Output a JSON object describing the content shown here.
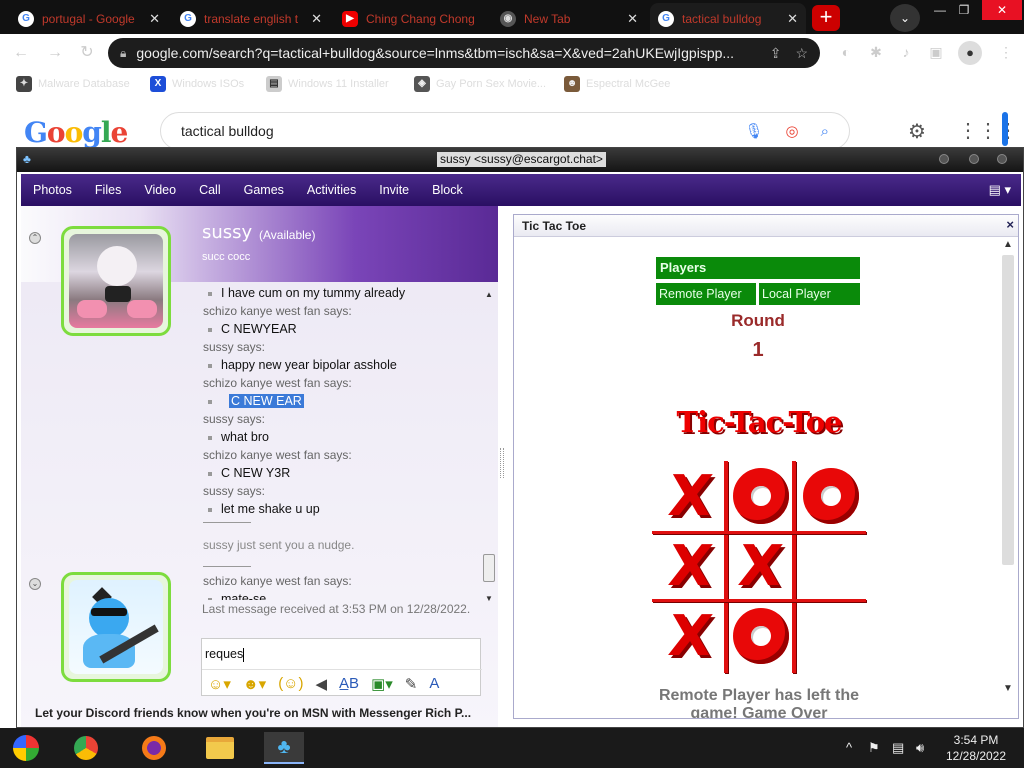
{
  "browser": {
    "tabs": [
      {
        "label": "portugal - Google",
        "icon": "google-icon"
      },
      {
        "label": "translate english t",
        "icon": "google-icon"
      },
      {
        "label": "Ching Chang Chong",
        "icon": "youtube-icon"
      },
      {
        "label": "New Tab",
        "icon": "chrome-icon"
      },
      {
        "label": "tactical bulldog",
        "icon": "google-icon"
      }
    ],
    "new_tab": "+",
    "url": "google.com/search?q=tactical+bulldog&source=lnms&tbm=isch&sa=X&ved=2ahUKEwjIgpispp...",
    "bookmarks": [
      "Malware Database",
      "Windows ISOs",
      "Windows 11 Installer",
      "Gay Porn Sex Movie...",
      "Espectral McGee"
    ]
  },
  "google": {
    "logo": "Google",
    "query": "tactical bulldog"
  },
  "messenger": {
    "title": "sussy <sussy@escargot.chat>",
    "menu": [
      "Photos",
      "Files",
      "Video",
      "Call",
      "Games",
      "Activities",
      "Invite",
      "Block"
    ],
    "contact": {
      "name": "sussy",
      "status": "(Available)",
      "personal_message": "succ cocc"
    },
    "chat": [
      {
        "type": "body",
        "text": "I have cum on my tummy already"
      },
      {
        "type": "sayer",
        "text": "schizo kanye west fan says:"
      },
      {
        "type": "body",
        "text": "C NEWYEAR"
      },
      {
        "type": "sayer",
        "text": "sussy says:"
      },
      {
        "type": "body",
        "text": "happy new year bipolar asshole"
      },
      {
        "type": "sayer",
        "text": "schizo kanye west fan says:"
      },
      {
        "type": "body",
        "text": "C NEW EAR"
      },
      {
        "type": "sayer",
        "text": "sussy says:"
      },
      {
        "type": "body",
        "text": "what bro"
      },
      {
        "type": "sayer",
        "text": "schizo kanye west fan says:"
      },
      {
        "type": "body",
        "text": "C NEW Y3R"
      },
      {
        "type": "sayer",
        "text": "sussy says:"
      },
      {
        "type": "body",
        "text": "let me shake u up"
      },
      {
        "type": "system",
        "text": "sussy just sent you a nudge."
      },
      {
        "type": "sayer",
        "text": "schizo kanye west fan says:"
      },
      {
        "type": "body",
        "text": "mate-se"
      }
    ],
    "last_message": "Last message received at 3:53 PM on 12/28/2022.",
    "compose_text": "reques",
    "discord_banner": "Let your Discord friends know when you're on MSN with Messenger Rich P..."
  },
  "tictactoe": {
    "panel_title": "Tic Tac Toe",
    "close": "×",
    "players_label": "Players",
    "remote_player": "Remote Player",
    "local_player": "Local Player",
    "round_label": "Round",
    "round_number": "1",
    "logo_text": "Tic-Tac-Toe",
    "board": [
      "X",
      "O",
      "O",
      "X",
      "X",
      "",
      "X",
      "O",
      ""
    ],
    "status": "Remote Player has left the game! Game Over"
  },
  "taskbar": {
    "time": "3:54 PM",
    "date": "12/28/2022"
  }
}
